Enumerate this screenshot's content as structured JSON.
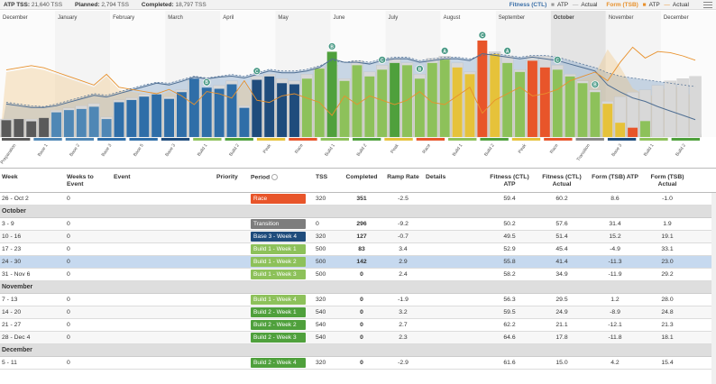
{
  "topbar": {
    "atp_label": "ATP TSS:",
    "atp_value": "21,640 TSS",
    "planned_label": "Planned:",
    "planned_value": "2,794 TSS",
    "completed_label": "Completed:",
    "completed_value": "18,797 TSS"
  },
  "legend": {
    "ctl_title": "Fitness (CTL)",
    "ctl_atp": "ATP",
    "ctl_actual": "Actual",
    "tsb_title": "Form (TSB)",
    "tsb_atp": "ATP",
    "tsb_actual": "Actual",
    "ctl_color": "#3a6fa8",
    "tsb_color": "#e8912c"
  },
  "chart_data": {
    "type": "bar",
    "months": [
      "December",
      "January",
      "February",
      "March",
      "April",
      "May",
      "June",
      "July",
      "August",
      "September",
      "October",
      "November",
      "December"
    ],
    "highlighted_month": "October",
    "week_count": 56,
    "planned_tss": [
      160,
      160,
      160,
      160,
      240,
      260,
      280,
      300,
      180,
      330,
      350,
      380,
      400,
      360,
      420,
      500,
      420,
      460,
      500,
      280,
      540,
      560,
      520,
      500,
      560,
      620,
      640,
      520,
      680,
      580,
      640,
      700,
      660,
      560,
      700,
      720,
      660,
      580,
      720,
      760,
      720,
      600,
      720,
      720,
      640,
      560,
      500,
      420,
      320,
      360,
      400,
      420,
      460,
      500,
      520,
      540
    ],
    "actual_tss": [
      150,
      160,
      140,
      170,
      220,
      240,
      250,
      270,
      160,
      310,
      330,
      360,
      380,
      340,
      400,
      520,
      440,
      430,
      470,
      260,
      510,
      540,
      480,
      470,
      520,
      610,
      760,
      500,
      640,
      540,
      600,
      660,
      640,
      520,
      660,
      690,
      620,
      560,
      860,
      740,
      660,
      580,
      680,
      620,
      600,
      540,
      480,
      400,
      296,
      127,
      83,
      142,
      0,
      0,
      0,
      0
    ],
    "bar_colors": [
      "#5a5a5a",
      "#5a5a5a",
      "#5a5a5a",
      "#5a5a5a",
      "#4f87b5",
      "#4f87b5",
      "#4f87b5",
      "#4f87b5",
      "#4f87b5",
      "#2f6ea8",
      "#2f6ea8",
      "#2f6ea8",
      "#2f6ea8",
      "#2f6ea8",
      "#2f6ea8",
      "#2f6ea8",
      "#2f6ea8",
      "#2f6ea8",
      "#2f6ea8",
      "#2f6ea8",
      "#1f4c7c",
      "#1f4c7c",
      "#1f4c7c",
      "#1f4c7c",
      "#8dc15a",
      "#8dc15a",
      "#4fa03c",
      "#8dc15a",
      "#8dc15a",
      "#8dc15a",
      "#8dc15a",
      "#4fa03c",
      "#8dc15a",
      "#8dc15a",
      "#8dc15a",
      "#8dc15a",
      "#e6c23a",
      "#e6c23a",
      "#e8552a",
      "#e6c23a",
      "#8dc15a",
      "#8dc15a",
      "#e8552a",
      "#e8552a",
      "#8dc15a",
      "#8dc15a",
      "#8dc15a",
      "#8dc15a",
      "#e6c23a",
      "#e6c23a",
      "#e8552a",
      "#8dc15a",
      "#1f4c7c",
      "#8dc15a",
      "#8dc15a",
      "#4fa03c"
    ],
    "ctl_atp": [
      40,
      38,
      36,
      35,
      38,
      42,
      46,
      50,
      48,
      52,
      56,
      60,
      63,
      62,
      66,
      70,
      68,
      70,
      72,
      70,
      74,
      78,
      76,
      76,
      78,
      82,
      88,
      86,
      88,
      86,
      90,
      92,
      92,
      88,
      90,
      92,
      92,
      90,
      94,
      96,
      94,
      92,
      94,
      94,
      92,
      88,
      84,
      80,
      74,
      70,
      68,
      66,
      64,
      62,
      60,
      58
    ],
    "ctl_actual": [
      38,
      36,
      34,
      34,
      36,
      40,
      44,
      48,
      46,
      50,
      54,
      58,
      62,
      60,
      64,
      69,
      67,
      69,
      70,
      68,
      72,
      76,
      74,
      74,
      76,
      80,
      90,
      86,
      86,
      84,
      88,
      90,
      90,
      86,
      88,
      90,
      90,
      88,
      96,
      94,
      92,
      90,
      92,
      90,
      88,
      84,
      80,
      76,
      60,
      52,
      45,
      41,
      35,
      30,
      25,
      20
    ],
    "tsb_atp": [
      10,
      12,
      14,
      12,
      8,
      4,
      0,
      -4,
      6,
      -6,
      -8,
      -10,
      -12,
      -8,
      -14,
      -18,
      -10,
      -12,
      -16,
      0,
      -18,
      -20,
      -14,
      -12,
      -16,
      -20,
      -26,
      -14,
      -22,
      -14,
      -18,
      -22,
      -18,
      -10,
      -20,
      -22,
      -14,
      -6,
      -24,
      -18,
      -12,
      -6,
      -14,
      -12,
      -8,
      0,
      4,
      8,
      31,
      15,
      -5,
      -11,
      -12,
      1,
      -9,
      -12
    ],
    "tsb_actual": [
      12,
      14,
      16,
      14,
      10,
      6,
      2,
      -2,
      8,
      -4,
      -6,
      -8,
      -10,
      -6,
      -12,
      -20,
      -8,
      -10,
      -14,
      2,
      -16,
      -18,
      -12,
      -10,
      -14,
      -18,
      -30,
      -12,
      -20,
      -12,
      -16,
      -20,
      -16,
      -8,
      -18,
      -20,
      -12,
      -4,
      -28,
      -16,
      -10,
      -4,
      -12,
      -10,
      -6,
      2,
      6,
      10,
      2,
      19,
      33,
      23,
      29,
      28,
      25,
      21
    ],
    "markers": [
      "B",
      "C",
      "B",
      "C",
      "A",
      "C",
      "B",
      "A",
      "C",
      "B"
    ],
    "period_labels": [
      "Preparation",
      "Base 1",
      "Base 2",
      "Base 3",
      "Base 5",
      "Base 3",
      "Build 1",
      "Build 2",
      "Peak",
      "Race",
      "Build 1",
      "Build 2",
      "Peak",
      "Race",
      "Build 1",
      "Build 2",
      "Peak",
      "Race",
      "Transition",
      "Base 3",
      "Build 1",
      "Build 2"
    ],
    "period_colors": [
      "#5a5a5a",
      "#4f87b5",
      "#4f87b5",
      "#2f6ea8",
      "#2f6ea8",
      "#1f4c7c",
      "#8dc15a",
      "#4fa03c",
      "#e6c23a",
      "#e8552a",
      "#8dc15a",
      "#4fa03c",
      "#e6c23a",
      "#e8552a",
      "#8dc15a",
      "#4fa03c",
      "#e6c23a",
      "#e8552a",
      "#888888",
      "#1f4c7c",
      "#8dc15a",
      "#4fa03c"
    ]
  },
  "table": {
    "headers": {
      "week": "Week",
      "weeks_to_event": "Weeks to Event",
      "event": "Event",
      "priority": "Priority",
      "period": "Period",
      "tss": "TSS",
      "completed": "Completed",
      "ramp_rate": "Ramp Rate",
      "details": "Details",
      "ctl_atp": "Fitness (CTL) ATP",
      "ctl_actual": "Fitness (CTL) Actual",
      "tsb_atp": "Form (TSB) ATP",
      "tsb_actual": "Form (TSB) Actual"
    },
    "rows": [
      {
        "kind": "row",
        "week": "26 - Oct 2",
        "wte": "0",
        "period": "Race",
        "pcolor": "#e8552a",
        "tss": "320",
        "completed": "351",
        "ramp": "-2.5",
        "ctl_atp": "59.4",
        "ctl_act": "60.2",
        "tsb_atp": "8.6",
        "tsb_act": "-1.0",
        "alt": false,
        "sel": false
      },
      {
        "kind": "month",
        "label": "October"
      },
      {
        "kind": "row",
        "week": "3 - 9",
        "wte": "0",
        "period": "Transition",
        "pcolor": "#7d7d7d",
        "tss": "0",
        "completed": "296",
        "ramp": "-9.2",
        "ctl_atp": "50.2",
        "ctl_act": "57.6",
        "tsb_atp": "31.4",
        "tsb_act": "1.9",
        "alt": false,
        "sel": false
      },
      {
        "kind": "row",
        "week": "10 - 16",
        "wte": "0",
        "period": "Base 3 - Week 4",
        "pcolor": "#1f4c7c",
        "tss": "320",
        "completed": "127",
        "ramp": "-0.7",
        "ctl_atp": "49.5",
        "ctl_act": "51.4",
        "tsb_atp": "15.2",
        "tsb_act": "19.1",
        "alt": true,
        "sel": false
      },
      {
        "kind": "row",
        "week": "17 - 23",
        "wte": "0",
        "period": "Build 1 - Week 1",
        "pcolor": "#8dc15a",
        "tss": "500",
        "completed": "83",
        "ramp": "3.4",
        "ctl_atp": "52.9",
        "ctl_act": "45.4",
        "tsb_atp": "-4.9",
        "tsb_act": "33.1",
        "alt": false,
        "sel": false
      },
      {
        "kind": "row",
        "week": "24 - 30",
        "wte": "0",
        "period": "Build 1 - Week 2",
        "pcolor": "#8dc15a",
        "tss": "500",
        "completed": "142",
        "ramp": "2.9",
        "ctl_atp": "55.8",
        "ctl_act": "41.4",
        "tsb_atp": "-11.3",
        "tsb_act": "23.0",
        "alt": false,
        "sel": true
      },
      {
        "kind": "row",
        "week": "31 - Nov 6",
        "wte": "0",
        "period": "Build 1 - Week 3",
        "pcolor": "#8dc15a",
        "tss": "500",
        "completed": "0",
        "ramp": "2.4",
        "ctl_atp": "58.2",
        "ctl_act": "34.9",
        "tsb_atp": "-11.9",
        "tsb_act": "29.2",
        "alt": false,
        "sel": false
      },
      {
        "kind": "month",
        "label": "November"
      },
      {
        "kind": "row",
        "week": "7 - 13",
        "wte": "0",
        "period": "Build 1 - Week 4",
        "pcolor": "#8dc15a",
        "tss": "320",
        "completed": "0",
        "ramp": "-1.9",
        "ctl_atp": "56.3",
        "ctl_act": "29.5",
        "tsb_atp": "1.2",
        "tsb_act": "28.0",
        "alt": false,
        "sel": false
      },
      {
        "kind": "row",
        "week": "14 - 20",
        "wte": "0",
        "period": "Build 2 - Week 1",
        "pcolor": "#4fa03c",
        "tss": "540",
        "completed": "0",
        "ramp": "3.2",
        "ctl_atp": "59.5",
        "ctl_act": "24.9",
        "tsb_atp": "-8.9",
        "tsb_act": "24.8",
        "alt": true,
        "sel": false
      },
      {
        "kind": "row",
        "week": "21 - 27",
        "wte": "0",
        "period": "Build 2 - Week 2",
        "pcolor": "#4fa03c",
        "tss": "540",
        "completed": "0",
        "ramp": "2.7",
        "ctl_atp": "62.2",
        "ctl_act": "21.1",
        "tsb_atp": "-12.1",
        "tsb_act": "21.3",
        "alt": false,
        "sel": false
      },
      {
        "kind": "row",
        "week": "28 - Dec 4",
        "wte": "0",
        "period": "Build 2 - Week 3",
        "pcolor": "#4fa03c",
        "tss": "540",
        "completed": "0",
        "ramp": "2.3",
        "ctl_atp": "64.6",
        "ctl_act": "17.8",
        "tsb_atp": "-11.8",
        "tsb_act": "18.1",
        "alt": true,
        "sel": false
      },
      {
        "kind": "month",
        "label": "December"
      },
      {
        "kind": "row",
        "week": "5 - 11",
        "wte": "0",
        "period": "Build 2 - Week 4",
        "pcolor": "#4fa03c",
        "tss": "320",
        "completed": "0",
        "ramp": "-2.9",
        "ctl_atp": "61.6",
        "ctl_act": "15.0",
        "tsb_atp": "4.2",
        "tsb_act": "15.4",
        "alt": false,
        "sel": false
      }
    ]
  }
}
